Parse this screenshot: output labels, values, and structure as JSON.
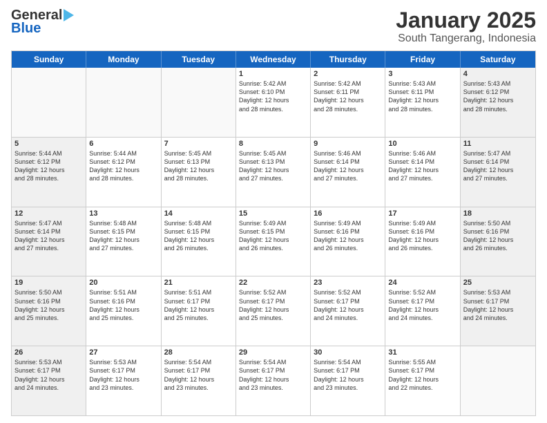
{
  "header": {
    "logo_line1": "General",
    "logo_line2": "Blue",
    "title": "January 2025",
    "subtitle": "South Tangerang, Indonesia"
  },
  "weekdays": [
    "Sunday",
    "Monday",
    "Tuesday",
    "Wednesday",
    "Thursday",
    "Friday",
    "Saturday"
  ],
  "rows": [
    [
      {
        "day": "",
        "text": "",
        "empty": true
      },
      {
        "day": "",
        "text": "",
        "empty": true
      },
      {
        "day": "",
        "text": "",
        "empty": true
      },
      {
        "day": "1",
        "text": "Sunrise: 5:42 AM\nSunset: 6:10 PM\nDaylight: 12 hours\nand 28 minutes."
      },
      {
        "day": "2",
        "text": "Sunrise: 5:42 AM\nSunset: 6:11 PM\nDaylight: 12 hours\nand 28 minutes."
      },
      {
        "day": "3",
        "text": "Sunrise: 5:43 AM\nSunset: 6:11 PM\nDaylight: 12 hours\nand 28 minutes."
      },
      {
        "day": "4",
        "text": "Sunrise: 5:43 AM\nSunset: 6:12 PM\nDaylight: 12 hours\nand 28 minutes.",
        "shaded": true
      }
    ],
    [
      {
        "day": "5",
        "text": "Sunrise: 5:44 AM\nSunset: 6:12 PM\nDaylight: 12 hours\nand 28 minutes.",
        "shaded": true
      },
      {
        "day": "6",
        "text": "Sunrise: 5:44 AM\nSunset: 6:12 PM\nDaylight: 12 hours\nand 28 minutes."
      },
      {
        "day": "7",
        "text": "Sunrise: 5:45 AM\nSunset: 6:13 PM\nDaylight: 12 hours\nand 28 minutes."
      },
      {
        "day": "8",
        "text": "Sunrise: 5:45 AM\nSunset: 6:13 PM\nDaylight: 12 hours\nand 27 minutes."
      },
      {
        "day": "9",
        "text": "Sunrise: 5:46 AM\nSunset: 6:14 PM\nDaylight: 12 hours\nand 27 minutes."
      },
      {
        "day": "10",
        "text": "Sunrise: 5:46 AM\nSunset: 6:14 PM\nDaylight: 12 hours\nand 27 minutes."
      },
      {
        "day": "11",
        "text": "Sunrise: 5:47 AM\nSunset: 6:14 PM\nDaylight: 12 hours\nand 27 minutes.",
        "shaded": true
      }
    ],
    [
      {
        "day": "12",
        "text": "Sunrise: 5:47 AM\nSunset: 6:14 PM\nDaylight: 12 hours\nand 27 minutes.",
        "shaded": true
      },
      {
        "day": "13",
        "text": "Sunrise: 5:48 AM\nSunset: 6:15 PM\nDaylight: 12 hours\nand 27 minutes."
      },
      {
        "day": "14",
        "text": "Sunrise: 5:48 AM\nSunset: 6:15 PM\nDaylight: 12 hours\nand 26 minutes."
      },
      {
        "day": "15",
        "text": "Sunrise: 5:49 AM\nSunset: 6:15 PM\nDaylight: 12 hours\nand 26 minutes."
      },
      {
        "day": "16",
        "text": "Sunrise: 5:49 AM\nSunset: 6:16 PM\nDaylight: 12 hours\nand 26 minutes."
      },
      {
        "day": "17",
        "text": "Sunrise: 5:49 AM\nSunset: 6:16 PM\nDaylight: 12 hours\nand 26 minutes."
      },
      {
        "day": "18",
        "text": "Sunrise: 5:50 AM\nSunset: 6:16 PM\nDaylight: 12 hours\nand 26 minutes.",
        "shaded": true
      }
    ],
    [
      {
        "day": "19",
        "text": "Sunrise: 5:50 AM\nSunset: 6:16 PM\nDaylight: 12 hours\nand 25 minutes.",
        "shaded": true
      },
      {
        "day": "20",
        "text": "Sunrise: 5:51 AM\nSunset: 6:16 PM\nDaylight: 12 hours\nand 25 minutes."
      },
      {
        "day": "21",
        "text": "Sunrise: 5:51 AM\nSunset: 6:17 PM\nDaylight: 12 hours\nand 25 minutes."
      },
      {
        "day": "22",
        "text": "Sunrise: 5:52 AM\nSunset: 6:17 PM\nDaylight: 12 hours\nand 25 minutes."
      },
      {
        "day": "23",
        "text": "Sunrise: 5:52 AM\nSunset: 6:17 PM\nDaylight: 12 hours\nand 24 minutes."
      },
      {
        "day": "24",
        "text": "Sunrise: 5:52 AM\nSunset: 6:17 PM\nDaylight: 12 hours\nand 24 minutes."
      },
      {
        "day": "25",
        "text": "Sunrise: 5:53 AM\nSunset: 6:17 PM\nDaylight: 12 hours\nand 24 minutes.",
        "shaded": true
      }
    ],
    [
      {
        "day": "26",
        "text": "Sunrise: 5:53 AM\nSunset: 6:17 PM\nDaylight: 12 hours\nand 24 minutes.",
        "shaded": true
      },
      {
        "day": "27",
        "text": "Sunrise: 5:53 AM\nSunset: 6:17 PM\nDaylight: 12 hours\nand 23 minutes."
      },
      {
        "day": "28",
        "text": "Sunrise: 5:54 AM\nSunset: 6:17 PM\nDaylight: 12 hours\nand 23 minutes."
      },
      {
        "day": "29",
        "text": "Sunrise: 5:54 AM\nSunset: 6:17 PM\nDaylight: 12 hours\nand 23 minutes."
      },
      {
        "day": "30",
        "text": "Sunrise: 5:54 AM\nSunset: 6:17 PM\nDaylight: 12 hours\nand 23 minutes."
      },
      {
        "day": "31",
        "text": "Sunrise: 5:55 AM\nSunset: 6:17 PM\nDaylight: 12 hours\nand 22 minutes."
      },
      {
        "day": "",
        "text": "",
        "empty": true,
        "shaded": true
      }
    ]
  ]
}
